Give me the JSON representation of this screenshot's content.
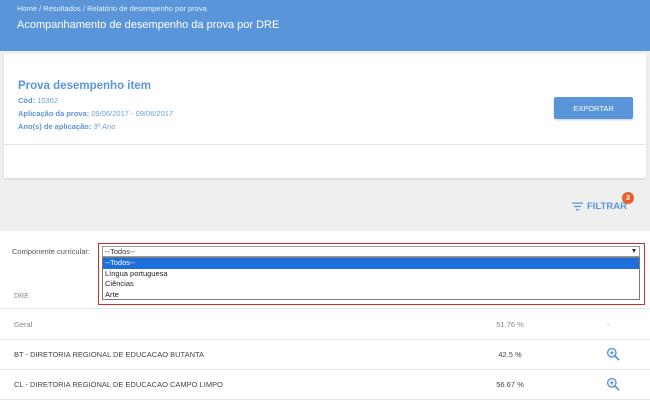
{
  "header": {
    "breadcrumb": [
      "Home",
      "Resultados",
      "Relatório de desempenho por prova"
    ],
    "breadcrumb_sep": " / ",
    "title": "Acompanhamento de desempenho da prova por DRE"
  },
  "card": {
    "title": "Prova desempenho item",
    "fields": [
      {
        "key": "Cód:",
        "value": "10302"
      },
      {
        "key": "Aplicação da prova:",
        "value": "09/06/2017 - 09/06/2017"
      },
      {
        "key": "Ano(s) de aplicação:",
        "value": "3º Ano"
      }
    ],
    "export_label": "EXPORTAR"
  },
  "filter": {
    "label": "FILTRAR",
    "badge_count": "3",
    "icon": "filter-lines-icon"
  },
  "component_filter": {
    "label": "Componente curricular:",
    "selected": "--Todos--",
    "options": [
      "--Todos--",
      "Língua portuguesa",
      "Ciências",
      "Arte"
    ],
    "highlighted_index": 0
  },
  "table": {
    "col_dre": "DRE",
    "rows": [
      {
        "name": "Geral",
        "value": "51.76 %",
        "action": "-"
      },
      {
        "name": "BT - DIRETORIA REGIONAL DE EDUCACAO BUTANTA",
        "value": "42.5 %",
        "action_icon": "zoom-in-icon"
      },
      {
        "name": "CL - DIRETORIA REGIONAL DE EDUCACAO CAMPO LIMPO",
        "value": "56.67 %",
        "action_icon": "zoom-in-icon"
      }
    ]
  },
  "colors": {
    "primary": "#5b95d9",
    "badge": "#e8632c",
    "select_highlight": "#1e6fdc",
    "outline": "#cf2c2c"
  }
}
